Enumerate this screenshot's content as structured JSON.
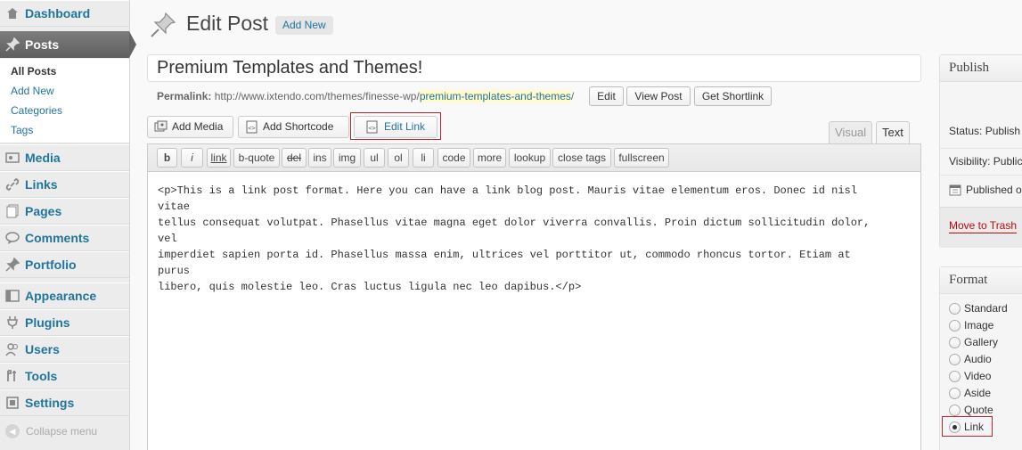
{
  "sidebar": {
    "items": [
      {
        "label": "Dashboard",
        "icon": "dashboard-icon"
      },
      {
        "label": "Posts",
        "icon": "pushpin-icon"
      },
      {
        "label": "Media",
        "icon": "media-icon"
      },
      {
        "label": "Links",
        "icon": "link-icon"
      },
      {
        "label": "Pages",
        "icon": "pages-icon"
      },
      {
        "label": "Comments",
        "icon": "comments-icon"
      },
      {
        "label": "Portfolio",
        "icon": "pushpin-icon"
      },
      {
        "label": "Appearance",
        "icon": "appearance-icon"
      },
      {
        "label": "Plugins",
        "icon": "plugins-icon"
      },
      {
        "label": "Users",
        "icon": "users-icon"
      },
      {
        "label": "Tools",
        "icon": "tools-icon"
      },
      {
        "label": "Settings",
        "icon": "settings-icon"
      }
    ],
    "submenu": [
      "All Posts",
      "Add New",
      "Categories",
      "Tags"
    ],
    "collapse_label": "Collapse menu"
  },
  "header": {
    "title": "Edit Post",
    "add_new": "Add New"
  },
  "post": {
    "title": "Premium Templates and Themes!",
    "permalink_label": "Permalink:",
    "permalink_base": "http://www.ixtendo.com/themes/finesse-wp/",
    "permalink_slug": "premium-templates-and-themes",
    "permalink_tail": "/",
    "edit_btn": "Edit",
    "view_btn": "View Post",
    "shortlink_btn": "Get Shortlink"
  },
  "media_buttons": {
    "add_media": "Add Media",
    "add_shortcode": "Add Shortcode",
    "edit_link": "Edit Link"
  },
  "tabs": {
    "visual": "Visual",
    "text": "Text"
  },
  "quicktags": [
    "b",
    "i",
    "link",
    "b-quote",
    "del",
    "ins",
    "img",
    "ul",
    "ol",
    "li",
    "code",
    "more",
    "lookup",
    "close tags",
    "fullscreen"
  ],
  "content": {
    "lines": [
      "<p>This is a link post format. Here you can have a link blog post. Mauris vitae elementum eros. Donec id nisl vitae",
      "tellus consequat volutpat. Phasellus vitae magna eget dolor viverra convallis. Proin dictum sollicitudin dolor, vel",
      "imperdiet sapien porta id. Phasellus massa enim, ultrices vel porttitor ut, commodo rhoncus tortor. Etiam at purus",
      "libero, quis molestie leo. Cras luctus ligula nec leo dapibus.</p>"
    ]
  },
  "publish": {
    "title": "Publish",
    "status": "Status: Publish",
    "visibility": "Visibility: Public",
    "published": "Published o",
    "trash": "Move to Trash"
  },
  "format": {
    "title": "Format",
    "options": [
      "Standard",
      "Image",
      "Gallery",
      "Audio",
      "Video",
      "Aside",
      "Quote",
      "Link"
    ],
    "selected": "Link"
  },
  "colors": {
    "link": "#21759b",
    "highlight_box": "#c0272d",
    "trash": "#bc0b0b",
    "slug_bg": "#fffbcc"
  }
}
